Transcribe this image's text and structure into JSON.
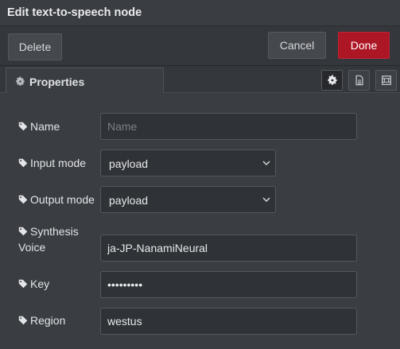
{
  "dialog": {
    "title": "Edit text-to-speech node"
  },
  "toolbar": {
    "delete_label": "Delete",
    "cancel_label": "Cancel",
    "done_label": "Done"
  },
  "tabs": {
    "properties_label": "Properties",
    "icons": [
      "gear-icon",
      "description-icon",
      "appearance-icon"
    ]
  },
  "form": {
    "name": {
      "label": "Name",
      "value": "",
      "placeholder": "Name"
    },
    "input_mode": {
      "label": "Input mode",
      "value": "payload"
    },
    "output_mode": {
      "label": "Output mode",
      "value": "payload"
    },
    "synthesis_voice": {
      "label_line1": "Synthesis",
      "label_line2": "Voice",
      "value": "ja-JP-NanamiNeural"
    },
    "key": {
      "label": "Key",
      "value": "•••••••••"
    },
    "region": {
      "label": "Region",
      "value": "westus"
    }
  },
  "colors": {
    "background": "#3a3d42",
    "input_bg": "#2f3236",
    "done_button": "#ad1625",
    "text": "#e3e5e8"
  }
}
